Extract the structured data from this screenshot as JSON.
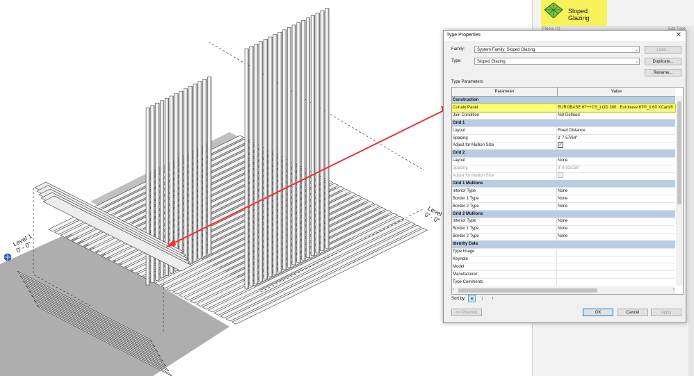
{
  "viewport": {
    "level_left": "Level 1",
    "level_left_elev": "0' - 0\"",
    "level_right": "Level 1",
    "level_right_elev": "0' - 0\""
  },
  "properties_panel": {
    "type_name": "Sloped Glazing",
    "strip_left": "Floors (1)",
    "strip_right": "Edit Type"
  },
  "dialog": {
    "title": "Type Properties",
    "family_label": "Family:",
    "family_value": "System Family: Sloped Glazing",
    "type_label": "Type:",
    "type_value": "Sloped Glazing",
    "load_button": "Load...",
    "duplicate_button": "Duplicate...",
    "rename_button": "Rename...",
    "section_label": "Type Parameters",
    "col_parameter": "Parameter",
    "col_value": "Value",
    "rows": [
      {
        "kind": "group",
        "param": "Construction",
        "value": ""
      },
      {
        "kind": "row",
        "param": "Curtain Panel",
        "value": "EUROBASE 67++CS_LOD 300 : Eurobase 67®_0.60 XCarb®",
        "highlight": true
      },
      {
        "kind": "row",
        "param": "Join Condition",
        "value": "Not Defined"
      },
      {
        "kind": "group",
        "param": "Grid 1",
        "value": ""
      },
      {
        "kind": "row",
        "param": "Layout",
        "value": "Fixed Distance"
      },
      {
        "kind": "row",
        "param": "Spacing",
        "value": "2'  7 57/64\""
      },
      {
        "kind": "row",
        "param": "Adjust for Mullion Size",
        "value": "",
        "checkbox": true
      },
      {
        "kind": "group",
        "param": "Grid 2",
        "value": ""
      },
      {
        "kind": "row",
        "param": "Layout",
        "value": "None"
      },
      {
        "kind": "row",
        "param": "Spacing",
        "value": "8'  6 93/256\"",
        "dim": true
      },
      {
        "kind": "row",
        "param": "Adjust for Mullion Size",
        "value": "",
        "checkbox": true,
        "dim": true
      },
      {
        "kind": "group",
        "param": "Grid 1 Mullions",
        "value": ""
      },
      {
        "kind": "row",
        "param": "Interior Type",
        "value": "None"
      },
      {
        "kind": "row",
        "param": "Border 1 Type",
        "value": "None"
      },
      {
        "kind": "row",
        "param": "Border 2 Type",
        "value": "None"
      },
      {
        "kind": "group",
        "param": "Grid 2 Mullions",
        "value": ""
      },
      {
        "kind": "row",
        "param": "Interior Type",
        "value": "None"
      },
      {
        "kind": "row",
        "param": "Border 1 Type",
        "value": "None"
      },
      {
        "kind": "row",
        "param": "Border 2 Type",
        "value": "None"
      },
      {
        "kind": "group",
        "param": "Identity Data",
        "value": ""
      },
      {
        "kind": "row",
        "param": "Type Image",
        "value": ""
      },
      {
        "kind": "row",
        "param": "Keynote",
        "value": ""
      },
      {
        "kind": "row",
        "param": "Model",
        "value": ""
      },
      {
        "kind": "row",
        "param": "Manufacturer",
        "value": ""
      },
      {
        "kind": "row",
        "param": "Type Comments",
        "value": ""
      }
    ],
    "sort_label": "Sort by:",
    "preview_button": "<< Preview",
    "ok_button": "OK",
    "cancel_button": "Cancel",
    "apply_button": "Apply"
  },
  "colors": {
    "highlight": "#ffff66",
    "group_row": "#b8cce4",
    "arrow": "#ee3333",
    "panel_yellow": "#f7f25a"
  },
  "icons": [
    "sloped-glazing-icon",
    "close-icon",
    "dropdown-arrow-icon",
    "checkbox-icon",
    "sort-grouped-icon",
    "sort-ascending-icon",
    "sort-descending-icon",
    "level-marker-icon"
  ]
}
